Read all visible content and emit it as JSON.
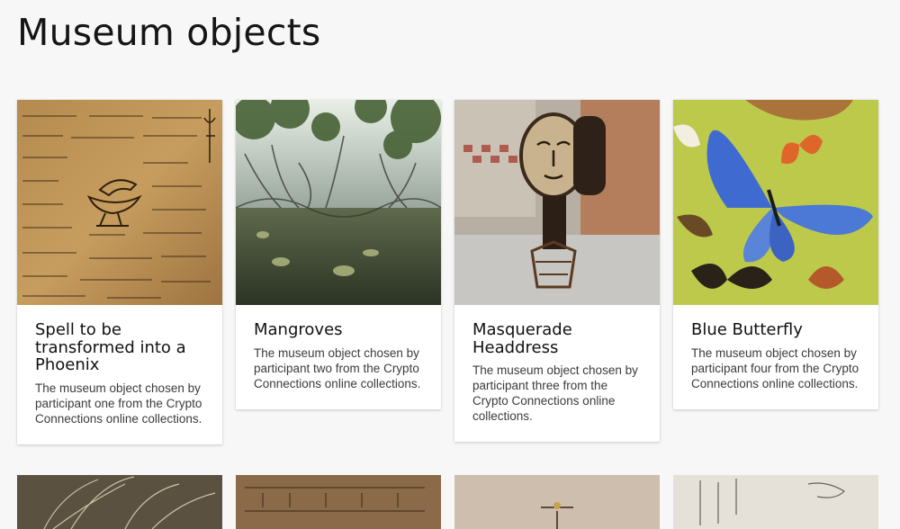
{
  "page": {
    "title": "Museum objects"
  },
  "cards": [
    {
      "title": "Spell to be transformed into a Phoenix",
      "description": "The museum object chosen by participant one from the Crypto Connections online collections.",
      "image_icon": "papyrus-image"
    },
    {
      "title": "Mangroves",
      "description": "The museum object chosen by participant two from the Crypto Connections online collections.",
      "image_icon": "mangroves-image"
    },
    {
      "title": "Masquerade Headdress",
      "description": "The museum object chosen by participant three from the Crypto Connections online collections.",
      "image_icon": "headdress-image"
    },
    {
      "title": "Blue Butterfly",
      "description": "The museum object chosen by participant four from the Crypto Connections online collections.",
      "image_icon": "butterfly-image"
    }
  ],
  "second_row": [
    {
      "image_icon": "cactus-image"
    },
    {
      "image_icon": "manuscript-image"
    },
    {
      "image_icon": "artifact-image"
    },
    {
      "image_icon": "script-paper-image"
    }
  ],
  "colors": {
    "background": "#f7f7f7",
    "card": "#ffffff",
    "text": "#151515"
  }
}
